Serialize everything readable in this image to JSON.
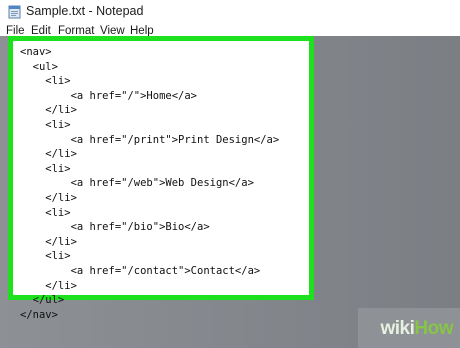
{
  "window": {
    "title": "Sample.txt - Notepad",
    "icon": "notepad-icon"
  },
  "menu": {
    "items": [
      {
        "label": "File"
      },
      {
        "label": "Edit"
      },
      {
        "label": "Format"
      },
      {
        "label": "View"
      },
      {
        "label": "Help"
      }
    ]
  },
  "editor": {
    "lines": [
      "<nav>",
      "  <ul>",
      "    <li>",
      "        <a href=\"/\">Home</a>",
      "    </li>",
      "    <li>",
      "        <a href=\"/print\">Print Design</a>",
      "    </li>",
      "    <li>",
      "        <a href=\"/web\">Web Design</a>",
      "    </li>",
      "    <li>",
      "        <a href=\"/bio\">Bio</a>",
      "    </li>",
      "    <li>",
      "        <a href=\"/contact\">Contact</a>",
      "    </li>",
      "  </ul>",
      "</nav>"
    ]
  },
  "watermark": {
    "part1": "wiki",
    "part2": "How"
  },
  "colors": {
    "highlight_border": "#1ee11e",
    "watermark_green": "#86c547"
  }
}
